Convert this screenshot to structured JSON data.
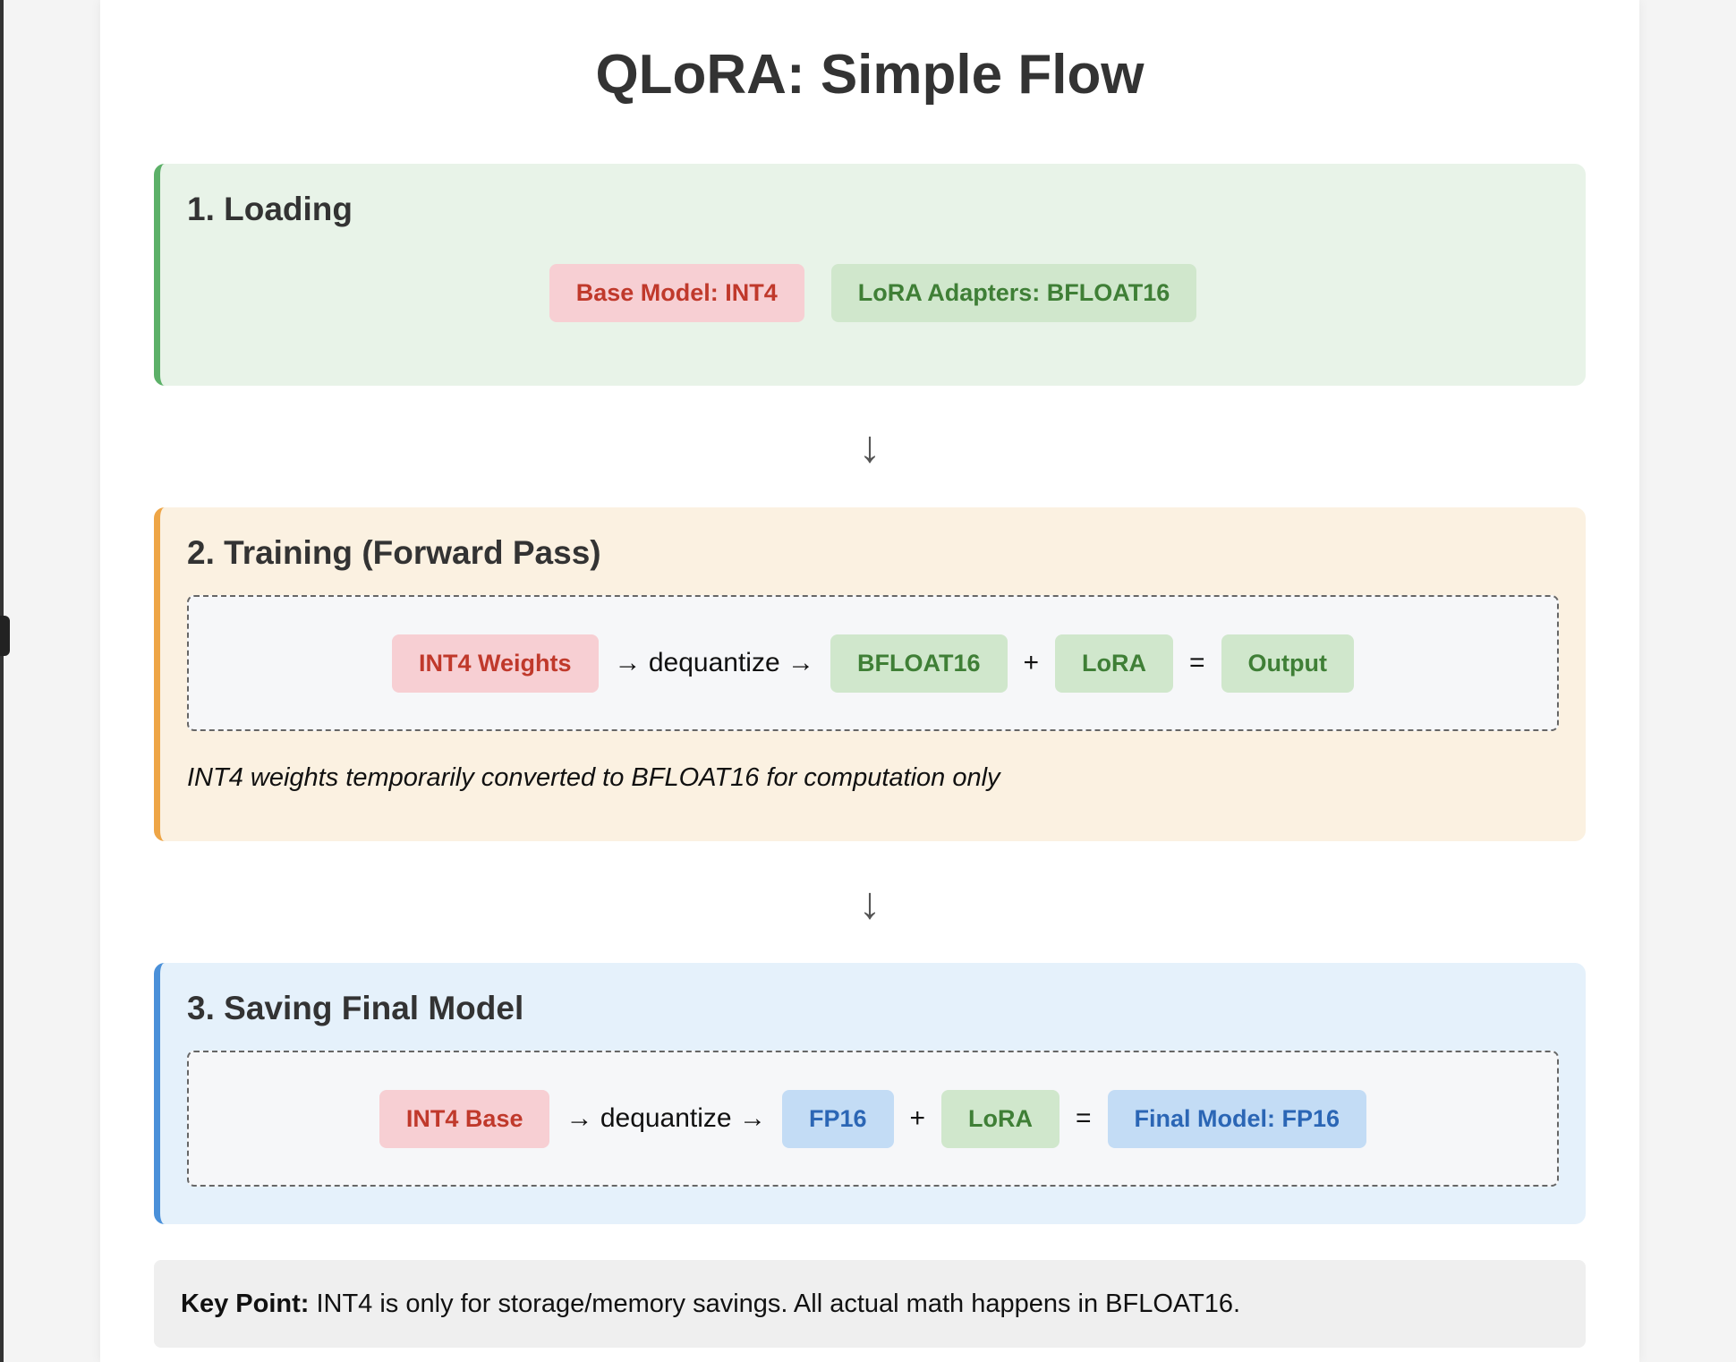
{
  "title": "QLoRA: Simple Flow",
  "arrow": "↓",
  "loading": {
    "heading": "1. Loading",
    "base": "Base Model: INT4",
    "adapters": "LoRA Adapters: BFLOAT16"
  },
  "training": {
    "heading": "2. Training (Forward Pass)",
    "weights": "INT4 Weights",
    "dequant": "→ dequantize →",
    "bf16": "BFLOAT16",
    "plus": "+",
    "lora": "LoRA",
    "eq": "=",
    "output": "Output",
    "note": "INT4 weights temporarily converted to BFLOAT16 for computation only"
  },
  "saving": {
    "heading": "3. Saving Final Model",
    "base": "INT4 Base",
    "dequant": "→ dequantize →",
    "fp16": "FP16",
    "plus": "+",
    "lora": "LoRA",
    "eq": "=",
    "final": "Final Model: FP16"
  },
  "key_point": {
    "label": "Key Point:",
    "text": " INT4 is only for storage/memory savings. All actual math happens in BFLOAT16."
  },
  "colors": {
    "red": "#c0392b",
    "green": "#3f7f36",
    "blue": "#2b66b5"
  }
}
